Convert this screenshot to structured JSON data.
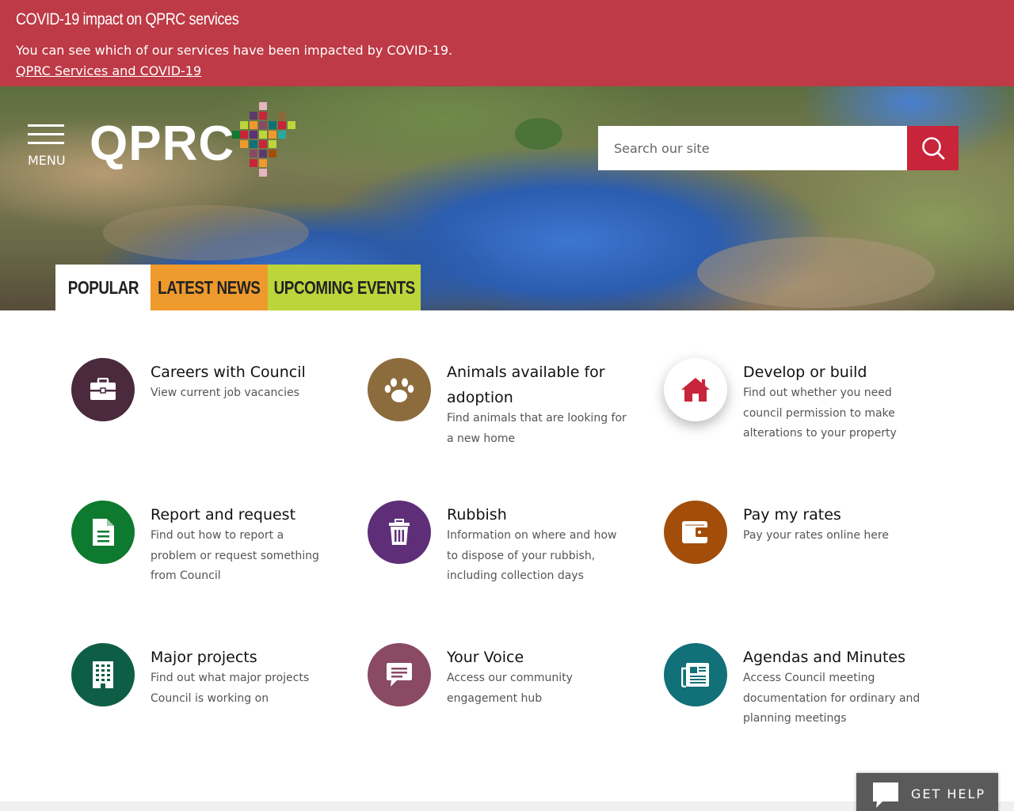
{
  "alert": {
    "title": "COVID-19 impact on QPRC services",
    "text": "You can see which of our services have been impacted by COVID-19.",
    "link": "QPRC Services and COVID-19"
  },
  "header": {
    "menu_label": "MENU",
    "logo_text": "QPRC",
    "search_placeholder": "Search our site"
  },
  "tabs": [
    {
      "label": "POPULAR",
      "color": "#ffffff"
    },
    {
      "label": "LATEST NEWS",
      "color": "#ee9a2c"
    },
    {
      "label": "UPCOMING EVENTS",
      "color": "#bcd53a"
    }
  ],
  "cards": [
    {
      "title": "Careers with Council",
      "desc": "View current job vacancies",
      "icon": "briefcase-icon",
      "color": "#4a2a3c"
    },
    {
      "title": "Animals available for adoption",
      "desc": "Find animals that are looking for a new home",
      "icon": "paw-icon",
      "color": "#8c6c3c"
    },
    {
      "title": "Develop or build",
      "desc": "Find out whether you need council permission to make alterations to your property",
      "icon": "house-icon",
      "color": "#c8243a"
    },
    {
      "title": "Report and request",
      "desc": "Find out how to report a problem or request something from Council",
      "icon": "document-icon",
      "color": "#0e7a2f"
    },
    {
      "title": "Rubbish",
      "desc": "Information on where and how to dispose of your rubbish, including collection days",
      "icon": "bin-icon",
      "color": "#5e2e78"
    },
    {
      "title": "Pay my rates",
      "desc": "Pay your rates online here",
      "icon": "wallet-icon",
      "color": "#a24e0a"
    },
    {
      "title": "Major projects",
      "desc": "Find out what major projects Council is working on",
      "icon": "building-icon",
      "color": "#0e5e46"
    },
    {
      "title": "Your Voice",
      "desc": "Access our community engagement hub",
      "icon": "chat-icon",
      "color": "#8a4a64"
    },
    {
      "title": "Agendas and Minutes",
      "desc": "Access Council meeting documentation for ordinary and planning meetings",
      "icon": "newspaper-icon",
      "color": "#117078"
    }
  ],
  "help": {
    "label": "GET HELP",
    "icon": "speech-bubble-icon"
  }
}
